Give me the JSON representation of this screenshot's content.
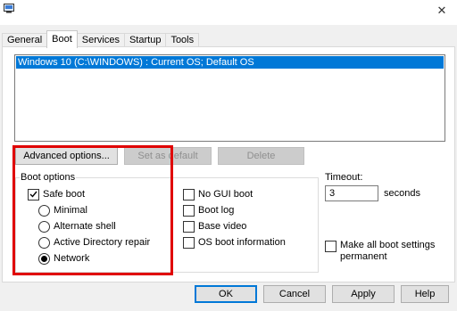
{
  "window": {
    "close_glyph": "✕"
  },
  "tabs": [
    {
      "label": "General"
    },
    {
      "label": "Boot"
    },
    {
      "label": "Services"
    },
    {
      "label": "Startup"
    },
    {
      "label": "Tools"
    }
  ],
  "os_list": {
    "items": [
      "Windows 10 (C:\\WINDOWS) : Current OS; Default OS"
    ]
  },
  "boot_buttons": {
    "advanced": "Advanced options...",
    "set_default": "Set as default",
    "delete": "Delete"
  },
  "boot_options": {
    "title": "Boot options",
    "safe_boot": {
      "label": "Safe boot",
      "checked": true
    },
    "radios": [
      {
        "label": "Minimal",
        "selected": false
      },
      {
        "label": "Alternate shell",
        "selected": false
      },
      {
        "label": "Active Directory repair",
        "selected": false
      },
      {
        "label": "Network",
        "selected": true
      }
    ],
    "right_checks": [
      {
        "label": "No GUI boot",
        "checked": false
      },
      {
        "label": "Boot log",
        "checked": false
      },
      {
        "label": "Base video",
        "checked": false
      },
      {
        "label": "OS boot information",
        "checked": false
      }
    ]
  },
  "timeout": {
    "label": "Timeout:",
    "value": "3",
    "unit": "seconds"
  },
  "permanent": {
    "line1": "Make all boot settings",
    "line2": "permanent",
    "checked": false
  },
  "footer": {
    "ok": "OK",
    "cancel": "Cancel",
    "apply": "Apply",
    "help": "Help"
  },
  "colors": {
    "selection": "#0078d7",
    "highlight_box": "#e00000"
  }
}
